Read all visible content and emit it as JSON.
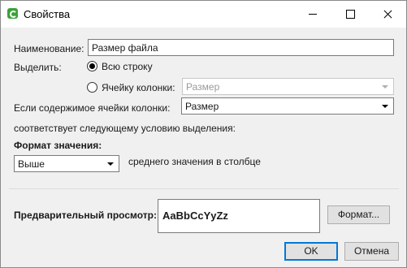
{
  "window": {
    "title": "Свойства",
    "icon": "app-leaf-icon"
  },
  "form": {
    "name_label": "Наименование:",
    "name_value": "Размер файла",
    "highlight_label": "Выделить:",
    "radio_whole_row": "Всю строку",
    "radio_column_cell": "Ячейку колонки:",
    "column_cell_value": "Размер",
    "content_label": "Если содержимое ячейки колонки:",
    "content_value": "Размер",
    "condition_text": "соответствует следующему условию выделения:",
    "value_format_label": "Формат значения:",
    "comparison_value": "Выше",
    "comparison_suffix": "среднего значения в столбце",
    "preview_label": "Предварительный просмотр:",
    "preview_sample": "AaBbCcYyZz",
    "format_button": "Формат..."
  },
  "footer": {
    "ok": "OK",
    "cancel": "Отмена"
  }
}
